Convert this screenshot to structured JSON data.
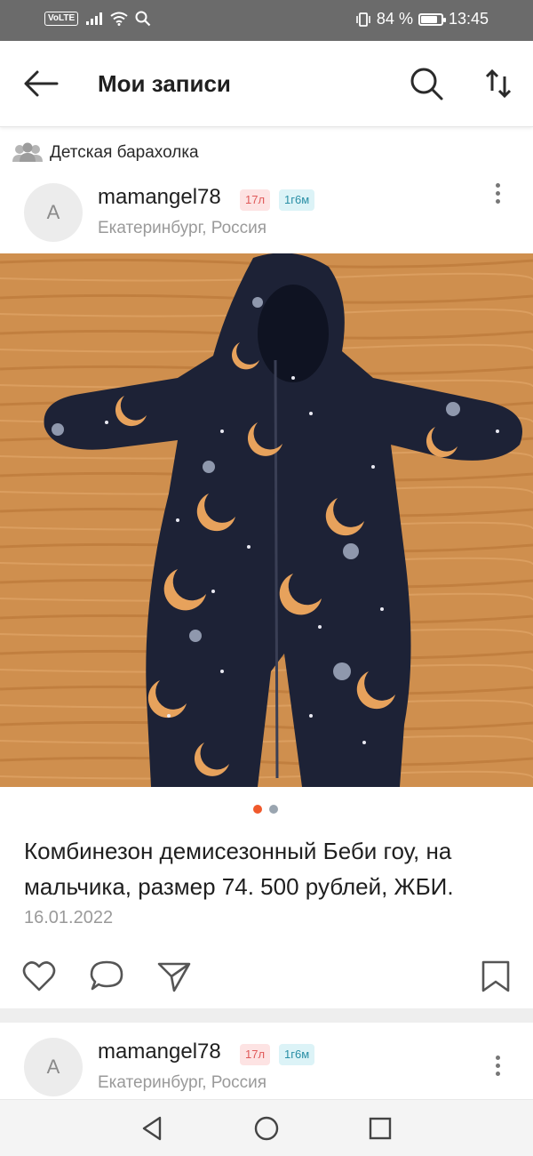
{
  "status_bar": {
    "network": "VoLTE",
    "battery": "84 %",
    "battery_level": 0.84,
    "time": "13:45",
    "icons": [
      "signal-icon",
      "wifi-icon",
      "search-icon",
      "vibrate-icon",
      "battery-icon"
    ]
  },
  "app_bar": {
    "title": "Мои записи",
    "icons": [
      "back-arrow-icon",
      "search-icon",
      "sort-icon"
    ]
  },
  "group": {
    "name": "Детская барахолка",
    "icon": "people-icon"
  },
  "posts": [
    {
      "avatar_letter": "A",
      "author": "mamangel78",
      "badge_age": "17л",
      "badge_kid": "1г6м",
      "location": "Екатеринбург, Россия",
      "text": "Комбинезон демисезонный Беби гоу, на мальчика, размер 74. 500 рублей, ЖБИ.",
      "date": "16.01.2022",
      "photo_count": 2,
      "active_photo": 1,
      "actions": [
        "heart-icon",
        "comment-icon",
        "share-icon",
        "bookmark-icon"
      ]
    },
    {
      "avatar_letter": "A",
      "author": "mamangel78",
      "badge_age": "17л",
      "badge_kid": "1г6м",
      "location": "Екатеринбург, Россия"
    }
  ],
  "nav_bar": {
    "icons": [
      "nav-back-icon",
      "nav-home-icon",
      "nav-recents-icon"
    ]
  },
  "colors": {
    "status_bar_bg": "#6b6b6b",
    "accent_dot": "#f0592c",
    "badge_age_bg": "#fde3e3",
    "badge_age_text": "#e05a5a",
    "badge_kid_bg": "#dcf3f7",
    "badge_kid_text": "#2a8fa6",
    "secondary_text": "#9a9a9a"
  }
}
